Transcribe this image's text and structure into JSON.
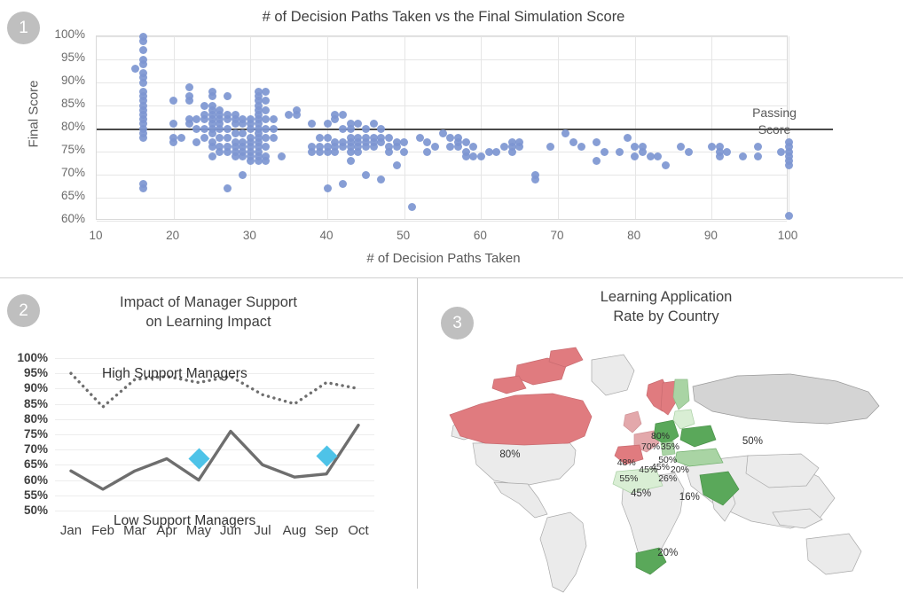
{
  "panels": [
    {
      "number": "1"
    },
    {
      "number": "2"
    },
    {
      "number": "3"
    }
  ],
  "panel1": {
    "badge": "1",
    "title": "# of Decision Paths Taken vs the Final Simulation Score",
    "ylabel": "Final Score",
    "xlabel": "# of Decision Paths Taken",
    "passing_note_line1": "Passing",
    "passing_note_line2": "Score"
  },
  "panel2": {
    "badge": "2",
    "title_line1": "Impact of Manager Support",
    "title_line2": "on Learning Impact",
    "high_label": "High Support Managers",
    "low_label": "Low Support Managers"
  },
  "panel3": {
    "badge": "3",
    "title_line1": "Learning Application",
    "title_line2": "Rate by Country"
  },
  "colors": {
    "dot_blue": "#7d96d1",
    "marker_cyan": "#4ec3e8",
    "line_gray": "#6e6e6e",
    "badge_gray": "#bfbfbf",
    "map_red": "#e07b7f",
    "map_red_light": "#e3a8ab",
    "map_green": "#5aa85a",
    "map_green_light": "#a9d4a4",
    "map_green_pale": "#d9eed4",
    "map_gray": "#d4d4d4",
    "map_gray_light": "#ebebeb",
    "passing_line": "#4a4a4a"
  },
  "chart_data": [
    {
      "type": "scatter",
      "title": "# of Decision Paths Taken vs the Final Simulation Score",
      "xlabel": "# of Decision Paths Taken",
      "ylabel": "Final Score",
      "xlim": [
        10,
        100
      ],
      "ylim": [
        60,
        100
      ],
      "xticks": [
        10,
        20,
        30,
        40,
        50,
        60,
        70,
        80,
        90,
        100
      ],
      "yticks": [
        "60%",
        "65%",
        "70%",
        "75%",
        "80%",
        "85%",
        "90%",
        "95%",
        "100%"
      ],
      "grid": true,
      "reference_line": {
        "label": "Passing Score",
        "y": 80
      },
      "points": [
        [
          15,
          93
        ],
        [
          16,
          100
        ],
        [
          16,
          99
        ],
        [
          16,
          97
        ],
        [
          16,
          95
        ],
        [
          16,
          94
        ],
        [
          16,
          92
        ],
        [
          16,
          91
        ],
        [
          16,
          90
        ],
        [
          16,
          88
        ],
        [
          16,
          87
        ],
        [
          16,
          86
        ],
        [
          16,
          85
        ],
        [
          16,
          84
        ],
        [
          16,
          83
        ],
        [
          16,
          82
        ],
        [
          16,
          81
        ],
        [
          16,
          80
        ],
        [
          16,
          79
        ],
        [
          16,
          78
        ],
        [
          16,
          68
        ],
        [
          16,
          67
        ],
        [
          20,
          86
        ],
        [
          20,
          81
        ],
        [
          20,
          78
        ],
        [
          20,
          77
        ],
        [
          21,
          78
        ],
        [
          22,
          89
        ],
        [
          22,
          87
        ],
        [
          22,
          86
        ],
        [
          22,
          82
        ],
        [
          22,
          81
        ],
        [
          23,
          82
        ],
        [
          23,
          80
        ],
        [
          23,
          77
        ],
        [
          24,
          85
        ],
        [
          24,
          83
        ],
        [
          24,
          82
        ],
        [
          24,
          80
        ],
        [
          24,
          78
        ],
        [
          25,
          88
        ],
        [
          25,
          87
        ],
        [
          25,
          85
        ],
        [
          25,
          84
        ],
        [
          25,
          83
        ],
        [
          25,
          82
        ],
        [
          25,
          81
        ],
        [
          25,
          80
        ],
        [
          25,
          79
        ],
        [
          25,
          77
        ],
        [
          25,
          76
        ],
        [
          25,
          74
        ],
        [
          26,
          84
        ],
        [
          26,
          83
        ],
        [
          26,
          82
        ],
        [
          26,
          81
        ],
        [
          26,
          80
        ],
        [
          26,
          78
        ],
        [
          26,
          76
        ],
        [
          26,
          75
        ],
        [
          27,
          87
        ],
        [
          27,
          83
        ],
        [
          27,
          82
        ],
        [
          27,
          80
        ],
        [
          27,
          78
        ],
        [
          27,
          76
        ],
        [
          27,
          75
        ],
        [
          27,
          67
        ],
        [
          28,
          83
        ],
        [
          28,
          82
        ],
        [
          28,
          81
        ],
        [
          28,
          79
        ],
        [
          28,
          77
        ],
        [
          28,
          76
        ],
        [
          28,
          75
        ],
        [
          28,
          74
        ],
        [
          29,
          82
        ],
        [
          29,
          81
        ],
        [
          29,
          79
        ],
        [
          29,
          77
        ],
        [
          29,
          76
        ],
        [
          29,
          75
        ],
        [
          29,
          74
        ],
        [
          29,
          70
        ],
        [
          30,
          82
        ],
        [
          30,
          81
        ],
        [
          30,
          80
        ],
        [
          30,
          78
        ],
        [
          30,
          77
        ],
        [
          30,
          76
        ],
        [
          30,
          75
        ],
        [
          30,
          74
        ],
        [
          30,
          73
        ],
        [
          31,
          88
        ],
        [
          31,
          87
        ],
        [
          31,
          86
        ],
        [
          31,
          85
        ],
        [
          31,
          84
        ],
        [
          31,
          83
        ],
        [
          31,
          82
        ],
        [
          31,
          81
        ],
        [
          31,
          80
        ],
        [
          31,
          79
        ],
        [
          31,
          78
        ],
        [
          31,
          77
        ],
        [
          31,
          76
        ],
        [
          31,
          75
        ],
        [
          31,
          74
        ],
        [
          31,
          73
        ],
        [
          32,
          88
        ],
        [
          32,
          86
        ],
        [
          32,
          84
        ],
        [
          32,
          82
        ],
        [
          32,
          80
        ],
        [
          32,
          78
        ],
        [
          32,
          76
        ],
        [
          32,
          74
        ],
        [
          32,
          73
        ],
        [
          33,
          82
        ],
        [
          33,
          80
        ],
        [
          33,
          78
        ],
        [
          34,
          74
        ],
        [
          35,
          83
        ],
        [
          36,
          84
        ],
        [
          36,
          83
        ],
        [
          38,
          81
        ],
        [
          38,
          76
        ],
        [
          38,
          75
        ],
        [
          39,
          78
        ],
        [
          39,
          76
        ],
        [
          39,
          75
        ],
        [
          40,
          81
        ],
        [
          40,
          78
        ],
        [
          40,
          76
        ],
        [
          40,
          75
        ],
        [
          40,
          67
        ],
        [
          41,
          83
        ],
        [
          41,
          82
        ],
        [
          41,
          77
        ],
        [
          41,
          76
        ],
        [
          41,
          75
        ],
        [
          42,
          83
        ],
        [
          42,
          80
        ],
        [
          42,
          77
        ],
        [
          42,
          76
        ],
        [
          42,
          68
        ],
        [
          43,
          81
        ],
        [
          43,
          80
        ],
        [
          43,
          78
        ],
        [
          43,
          77
        ],
        [
          43,
          76
        ],
        [
          43,
          75
        ],
        [
          43,
          73
        ],
        [
          44,
          81
        ],
        [
          44,
          78
        ],
        [
          44,
          77
        ],
        [
          44,
          76
        ],
        [
          44,
          75
        ],
        [
          45,
          80
        ],
        [
          45,
          78
        ],
        [
          45,
          77
        ],
        [
          45,
          76
        ],
        [
          45,
          70
        ],
        [
          46,
          81
        ],
        [
          46,
          78
        ],
        [
          46,
          77
        ],
        [
          46,
          76
        ],
        [
          47,
          80
        ],
        [
          47,
          78
        ],
        [
          47,
          77
        ],
        [
          47,
          69
        ],
        [
          48,
          78
        ],
        [
          48,
          76
        ],
        [
          48,
          75
        ],
        [
          49,
          77
        ],
        [
          49,
          76
        ],
        [
          49,
          72
        ],
        [
          50,
          77
        ],
        [
          50,
          75
        ],
        [
          51,
          63
        ],
        [
          52,
          78
        ],
        [
          53,
          77
        ],
        [
          53,
          75
        ],
        [
          54,
          76
        ],
        [
          55,
          79
        ],
        [
          56,
          78
        ],
        [
          56,
          76
        ],
        [
          57,
          78
        ],
        [
          57,
          77
        ],
        [
          57,
          76
        ],
        [
          58,
          77
        ],
        [
          58,
          75
        ],
        [
          58,
          74
        ],
        [
          59,
          76
        ],
        [
          59,
          74
        ],
        [
          60,
          74
        ],
        [
          61,
          75
        ],
        [
          62,
          75
        ],
        [
          63,
          76
        ],
        [
          64,
          77
        ],
        [
          64,
          76
        ],
        [
          64,
          75
        ],
        [
          65,
          77
        ],
        [
          65,
          76
        ],
        [
          67,
          70
        ],
        [
          67,
          69
        ],
        [
          69,
          76
        ],
        [
          71,
          79
        ],
        [
          72,
          77
        ],
        [
          73,
          76
        ],
        [
          75,
          77
        ],
        [
          75,
          73
        ],
        [
          76,
          75
        ],
        [
          78,
          75
        ],
        [
          79,
          78
        ],
        [
          80,
          76
        ],
        [
          80,
          74
        ],
        [
          81,
          76
        ],
        [
          81,
          75
        ],
        [
          82,
          74
        ],
        [
          83,
          74
        ],
        [
          84,
          72
        ],
        [
          86,
          76
        ],
        [
          87,
          75
        ],
        [
          90,
          76
        ],
        [
          91,
          76
        ],
        [
          91,
          75
        ],
        [
          91,
          74
        ],
        [
          92,
          75
        ],
        [
          94,
          74
        ],
        [
          96,
          76
        ],
        [
          96,
          74
        ],
        [
          99,
          75
        ],
        [
          100,
          77
        ],
        [
          100,
          76
        ],
        [
          100,
          75
        ],
        [
          100,
          74
        ],
        [
          100,
          73
        ],
        [
          100,
          72
        ],
        [
          100,
          61
        ]
      ]
    },
    {
      "type": "line",
      "title": "Impact of Manager Support on Learning Impact",
      "xlabel": "",
      "ylabel": "",
      "categories": [
        "Jan",
        "Feb",
        "Mar",
        "Apr",
        "May",
        "Jun",
        "Jul",
        "Aug",
        "Sep",
        "Oct"
      ],
      "ylim": [
        50,
        100
      ],
      "yticks": [
        "50%",
        "55%",
        "60%",
        "65%",
        "70%",
        "75%",
        "80%",
        "85%",
        "90%",
        "95%",
        "100%"
      ],
      "grid": true,
      "series": [
        {
          "name": "High Support Managers",
          "style": "dotted",
          "color": "#6e6e6e",
          "values": [
            95,
            84,
            93,
            94,
            92,
            94,
            88,
            85,
            92,
            90
          ]
        },
        {
          "name": "Low Support Managers",
          "style": "solid",
          "color": "#6e6e6e",
          "values": [
            63,
            57,
            63,
            67,
            60,
            76,
            65,
            61,
            62,
            78
          ]
        }
      ],
      "markers": [
        {
          "series": "Low Support Managers",
          "category": "May",
          "value": 67,
          "color": "#4ec3e8",
          "shape": "diamond"
        },
        {
          "series": "Low Support Managers",
          "category": "Sep",
          "value": 68,
          "color": "#4ec3e8",
          "shape": "diamond"
        }
      ]
    },
    {
      "type": "map",
      "title": "Learning Application Rate by Country",
      "value_suffix": "%",
      "regions": [
        {
          "name": "Canada",
          "value": "80%",
          "color": "#e07b7f",
          "x": 19,
          "y": 47
        },
        {
          "name": "Russia",
          "value": "50%",
          "color": "#d4d4d4",
          "x": 69,
          "y": 42
        },
        {
          "name": "Norway",
          "value": "80%",
          "color": "#e07b7f",
          "x": 50,
          "y": 40
        },
        {
          "name": "Sweden",
          "value": "70%",
          "color": "#e07b7f",
          "x": 48,
          "y": 44
        },
        {
          "name": "Finland",
          "value": "35%",
          "color": "#b8dcb0",
          "x": 52,
          "y": 44
        },
        {
          "name": "Belarus",
          "value": "50%",
          "color": "#cfe8c9",
          "x": 51.5,
          "y": 49
        },
        {
          "name": "Ukraine",
          "value": "20%",
          "color": "#5aa85a",
          "x": 54,
          "y": 52.5
        },
        {
          "name": "United Kingdom",
          "value": "48%",
          "color": "#e3a8ab",
          "x": 43,
          "y": 50
        },
        {
          "name": "France",
          "value": "45%",
          "color": "#e3a8ab",
          "x": 47.5,
          "y": 52.5
        },
        {
          "name": "Germany",
          "value": "45%",
          "color": "#5aa85a",
          "x": 50,
          "y": 51.5
        },
        {
          "name": "Spain",
          "value": "55%",
          "color": "#e07b7f",
          "x": 43.5,
          "y": 56
        },
        {
          "name": "Romania",
          "value": "26%",
          "color": "#5aa85a",
          "x": 51.5,
          "y": 56
        },
        {
          "name": "Algeria",
          "value": "45%",
          "color": "#d9eed4",
          "x": 46,
          "y": 61.5
        },
        {
          "name": "Saudi Arabia",
          "value": "16%",
          "color": "#5aa85a",
          "x": 56,
          "y": 63
        },
        {
          "name": "South Africa",
          "value": "20%",
          "color": "#5aa85a",
          "x": 51.5,
          "y": 84
        }
      ]
    }
  ]
}
